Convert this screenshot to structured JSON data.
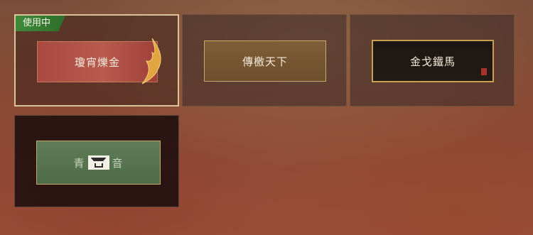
{
  "badge": {
    "label": "使用中"
  },
  "cards": [
    {
      "label": "瓊宵爍金",
      "selected": true,
      "style": "red-cloud"
    },
    {
      "label": "傳檄天下",
      "selected": false,
      "style": "gold-plain"
    },
    {
      "label": "金戈鐵馬",
      "selected": false,
      "style": "black-ink"
    },
    {
      "label_left": "青",
      "label_right": "音",
      "selected": false,
      "style": "green-landscape"
    }
  ],
  "colors": {
    "badge": "#3f8a3a",
    "selected_border": "#d9c39a",
    "gold_border": "#c9a04e"
  }
}
